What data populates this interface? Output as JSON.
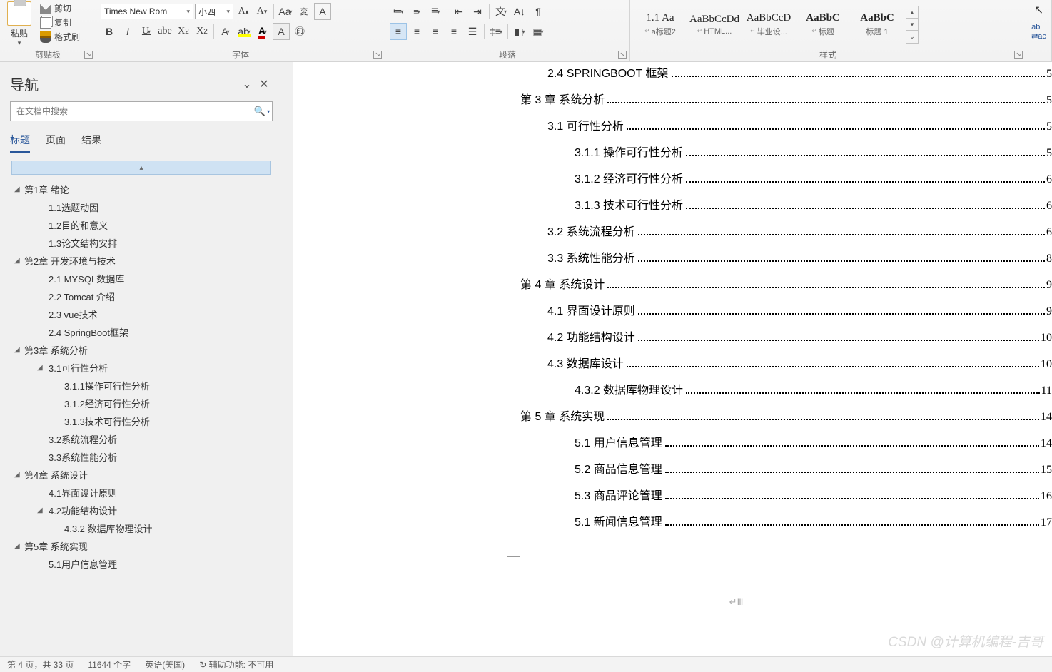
{
  "ribbon": {
    "clipboard": {
      "paste": "粘贴",
      "cut": "剪切",
      "copy": "复制",
      "format_painter": "格式刷",
      "group": "剪贴板"
    },
    "font": {
      "name": "Times New Rom",
      "size": "小四",
      "group": "字体"
    },
    "paragraph": {
      "group": "段落"
    },
    "styles": {
      "group": "样式",
      "items": [
        {
          "preview": "1.1  Aa",
          "name": "a标题2",
          "para": true
        },
        {
          "preview": "AaBbCcDd",
          "name": "HTML...",
          "para": true
        },
        {
          "preview": "AaBbCcD",
          "name": "毕业设...",
          "para": true
        },
        {
          "preview": "AaBbC",
          "name": "标题",
          "para": true,
          "bold": true
        },
        {
          "preview": "AaBbC",
          "name": "标题 1",
          "para": false,
          "bold": true
        }
      ]
    }
  },
  "nav": {
    "title": "导航",
    "search_placeholder": "在文档中搜索",
    "tabs": {
      "headings": "标题",
      "pages": "页面",
      "results": "结果"
    },
    "outline": [
      {
        "lv": 1,
        "caret": true,
        "t": "第1章 绪论"
      },
      {
        "lv": 2,
        "t": "1.1选题动因"
      },
      {
        "lv": 2,
        "t": "1.2目的和意义"
      },
      {
        "lv": 2,
        "t": "1.3论文结构安排"
      },
      {
        "lv": 1,
        "caret": true,
        "t": "第2章 开发环境与技术"
      },
      {
        "lv": 2,
        "t": "2.1 MYSQL数据库"
      },
      {
        "lv": 2,
        "t": "2.2 Tomcat 介绍"
      },
      {
        "lv": 2,
        "t": "2.3 vue技术"
      },
      {
        "lv": 2,
        "t": "2.4 SpringBoot框架"
      },
      {
        "lv": 1,
        "caret": true,
        "t": "第3章 系统分析"
      },
      {
        "lv": 2,
        "caret": true,
        "t": "3.1可行性分析"
      },
      {
        "lv": 3,
        "t": "3.1.1操作可行性分析"
      },
      {
        "lv": 3,
        "t": "3.1.2经济可行性分析"
      },
      {
        "lv": 3,
        "t": "3.1.3技术可行性分析"
      },
      {
        "lv": 2,
        "t": "3.2系统流程分析"
      },
      {
        "lv": 2,
        "t": "3.3系统性能分析"
      },
      {
        "lv": 1,
        "caret": true,
        "t": "第4章 系统设计"
      },
      {
        "lv": 2,
        "t": "4.1界面设计原则"
      },
      {
        "lv": 2,
        "caret": true,
        "t": "4.2功能结构设计"
      },
      {
        "lv": 3,
        "t": "4.3.2 数据库物理设计"
      },
      {
        "lv": 1,
        "caret": true,
        "t": "第5章 系统实现"
      },
      {
        "lv": 2,
        "t": "5.1用户信息管理"
      }
    ]
  },
  "toc": [
    {
      "ind": 1,
      "title": "2.4 SPRINGBOOT 框架",
      "pn": "5",
      "sc": true
    },
    {
      "ind": 0,
      "title": "第 3 章  系统分析",
      "pn": "5"
    },
    {
      "ind": 1,
      "title": "3.1 可行性分析",
      "pn": "5"
    },
    {
      "ind": 2,
      "title": "3.1.1 操作可行性分析",
      "pn": "5"
    },
    {
      "ind": 2,
      "title": "3.1.2 经济可行性分析",
      "pn": "6"
    },
    {
      "ind": 2,
      "title": "3.1.3 技术可行性分析",
      "pn": "6"
    },
    {
      "ind": 1,
      "title": "3.2 系统流程分析",
      "pn": "6"
    },
    {
      "ind": 1,
      "title": "3.3 系统性能分析",
      "pn": "8"
    },
    {
      "ind": 0,
      "title": "第 4 章  系统设计",
      "pn": "9"
    },
    {
      "ind": 1,
      "title": "4.1 界面设计原则",
      "pn": "9"
    },
    {
      "ind": 1,
      "title": "4.2 功能结构设计",
      "pn": "10"
    },
    {
      "ind": 1,
      "title": "4.3 数据库设计",
      "pn": "10"
    },
    {
      "ind": 2,
      "title": "4.3.2 数据库物理设计",
      "pn": "11"
    },
    {
      "ind": 0,
      "title": "第 5 章  系统实现",
      "pn": "14"
    },
    {
      "ind": 2,
      "title": "5.1 用户信息管理",
      "pn": "14"
    },
    {
      "ind": 2,
      "title": "5.2 商品信息管理",
      "pn": "15"
    },
    {
      "ind": 2,
      "title": "5.3 商品评论管理",
      "pn": "16"
    },
    {
      "ind": 2,
      "title": "5.1 新闻信息管理",
      "pn": "17"
    }
  ],
  "page_end": "␋Ⅲ",
  "status": {
    "page": "第 4 页，共 33 页",
    "words": "11644 个字",
    "lang": "英语(美国)",
    "a11y": "辅助功能: 不可用"
  },
  "watermark": "CSDN @计算机编程-吉哥"
}
